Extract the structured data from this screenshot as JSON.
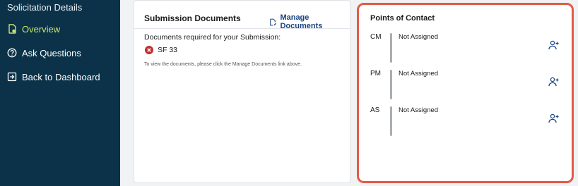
{
  "sidebar": {
    "title": "Solicitation Details",
    "items": [
      {
        "label": "Overview",
        "icon": "document-icon",
        "active": true
      },
      {
        "label": "Ask Questions",
        "icon": "question-icon",
        "active": false
      },
      {
        "label": "Back to Dashboard",
        "icon": "exit-icon",
        "active": false
      }
    ]
  },
  "documents": {
    "title": "Submission Documents",
    "manage_label": "Manage Documents",
    "required_label": "Documents required for your Submission:",
    "items": [
      {
        "label": "SF 33",
        "status": "missing"
      }
    ],
    "note": "To view the documents, please click the Manage Documents link above."
  },
  "contacts": {
    "title": "Points of Contact",
    "rows": [
      {
        "role": "CM",
        "name": "Not Assigned"
      },
      {
        "role": "PM",
        "name": "Not Assigned"
      },
      {
        "role": "AS",
        "name": "Not Assigned"
      }
    ]
  },
  "colors": {
    "sidebar_bg": "#0b3248",
    "active_nav": "#c8e56f",
    "link": "#1a4480",
    "highlight_border": "#e35a47",
    "error": "#c42f2f"
  }
}
